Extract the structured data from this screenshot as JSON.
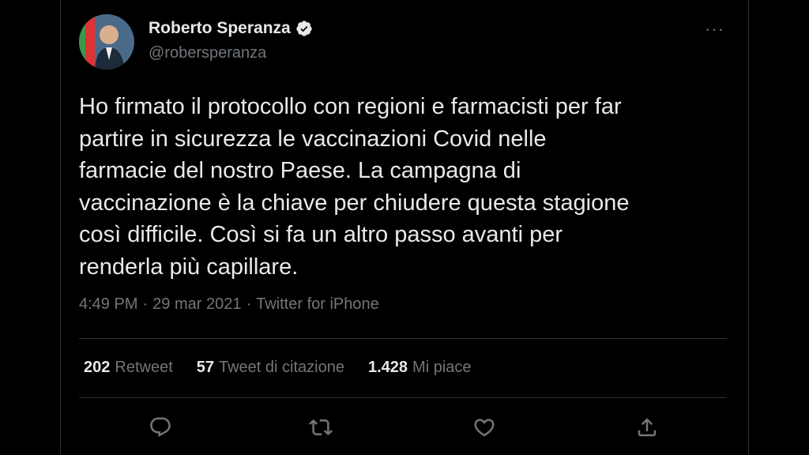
{
  "tweet": {
    "author_name": "Roberto Speranza",
    "author_handle": "@robersperanza",
    "text": "Ho firmato il protocollo con regioni e farmacisti per far\npartire in sicurezza le vaccinazioni Covid nelle\nfarmacie del nostro Paese. La campagna di\nvaccinazione è la chiave per chiudere questa stagione\ncosì difficile. Così si fa un altro passo avanti per\nrenderla più capillare.",
    "time": "4:49 PM",
    "date": "29 mar 2021",
    "source": "Twitter for iPhone",
    "separator": "·"
  },
  "stats": {
    "retweets_count": "202",
    "retweets_label": "Retweet",
    "quotes_count": "57",
    "quotes_label": "Tweet di citazione",
    "likes_count": "1.428",
    "likes_label": "Mi piace"
  },
  "icons": {
    "more": "more-icon",
    "verified": "verified-badge-icon",
    "reply": "reply-icon",
    "retweet": "retweet-icon",
    "like": "like-icon",
    "share": "share-icon"
  },
  "colors": {
    "background": "#000000",
    "text_primary": "#e7e9ea",
    "text_secondary": "#71767b",
    "divider": "#2f3336"
  },
  "more_label": "···"
}
